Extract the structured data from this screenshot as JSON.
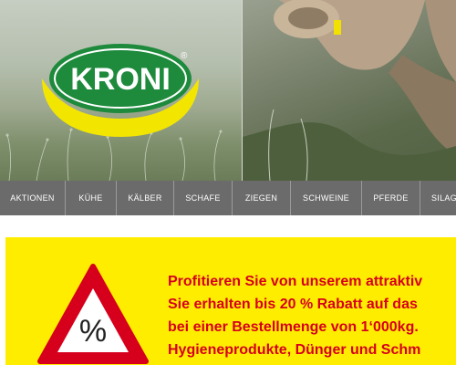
{
  "logo": {
    "brand": "KRONI",
    "registered": "®"
  },
  "nav": {
    "items": [
      {
        "label": "AKTIONEN"
      },
      {
        "label": "KÜHE"
      },
      {
        "label": "KÄLBER"
      },
      {
        "label": "SCHAFE"
      },
      {
        "label": "ZIEGEN"
      },
      {
        "label": "SCHWEINE"
      },
      {
        "label": "PFERDE"
      },
      {
        "label": "SILAG"
      }
    ]
  },
  "promo": {
    "icon_symbol": "%",
    "lines": [
      "Profitieren Sie von unserem attraktiv",
      "Sie erhalten bis 20 % Rabatt auf das",
      "bei einer Bestellmenge von 1‘000kg.",
      "Hygieneprodukte, Dünger und  Schm"
    ]
  },
  "colors": {
    "nav_bg": "#6b6b6b",
    "promo_bg": "#ffed00",
    "promo_text": "#d6001c",
    "logo_green": "#1e8a3c",
    "logo_yellow": "#f2e600"
  }
}
